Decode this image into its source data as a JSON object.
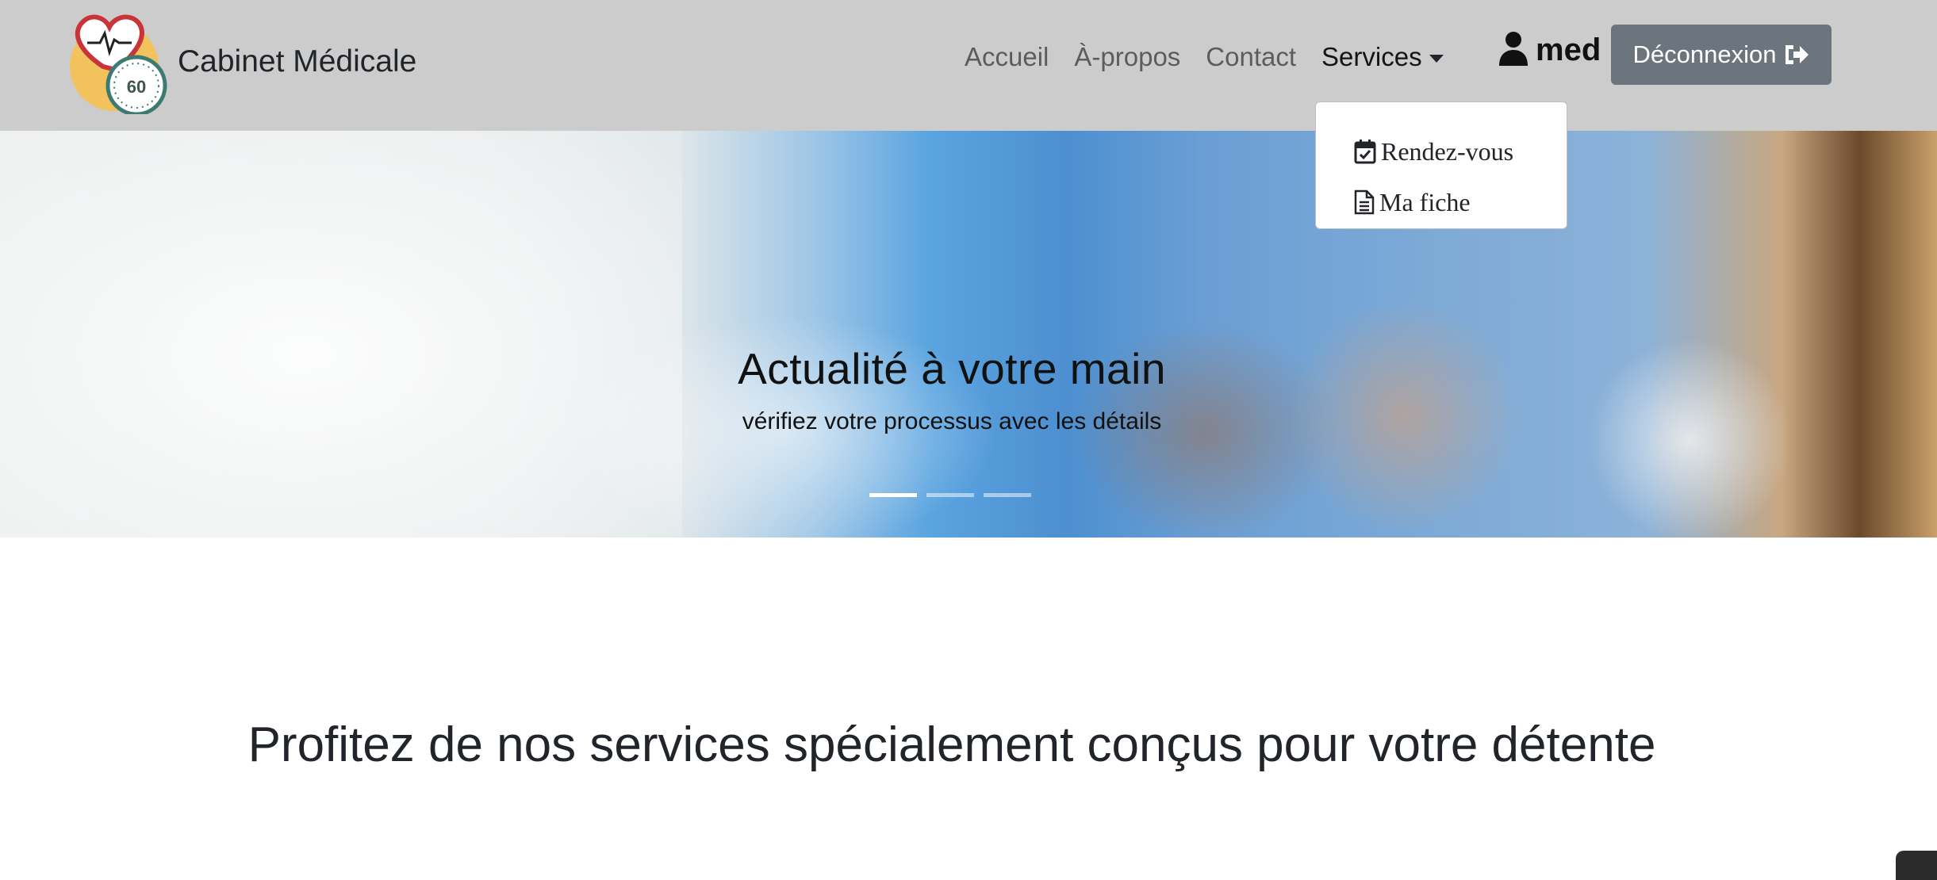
{
  "navbar": {
    "brand_name": "Cabinet Médicale",
    "logo_number": "60",
    "links": [
      {
        "label": "Accueil"
      },
      {
        "label": "À-propos"
      },
      {
        "label": "Contact"
      },
      {
        "label": "Services"
      }
    ],
    "user_name": "med",
    "logout_label": "Déconnexion"
  },
  "dropdown": {
    "items": [
      {
        "label": "Rendez-vous",
        "icon": "calendar-check-icon"
      },
      {
        "label": "Ma fiche",
        "icon": "file-text-icon"
      }
    ]
  },
  "hero": {
    "title": "Actualité à votre main",
    "subtitle": "vérifiez votre processus avec les détails",
    "active_slide": 1,
    "slide_count": 3
  },
  "section": {
    "title": "Profitez de nos services spécialement conçus pour votre détente"
  },
  "colors": {
    "navbar_bg": "#cccccc",
    "logout_button": "#6c757d",
    "text": "#212529"
  }
}
